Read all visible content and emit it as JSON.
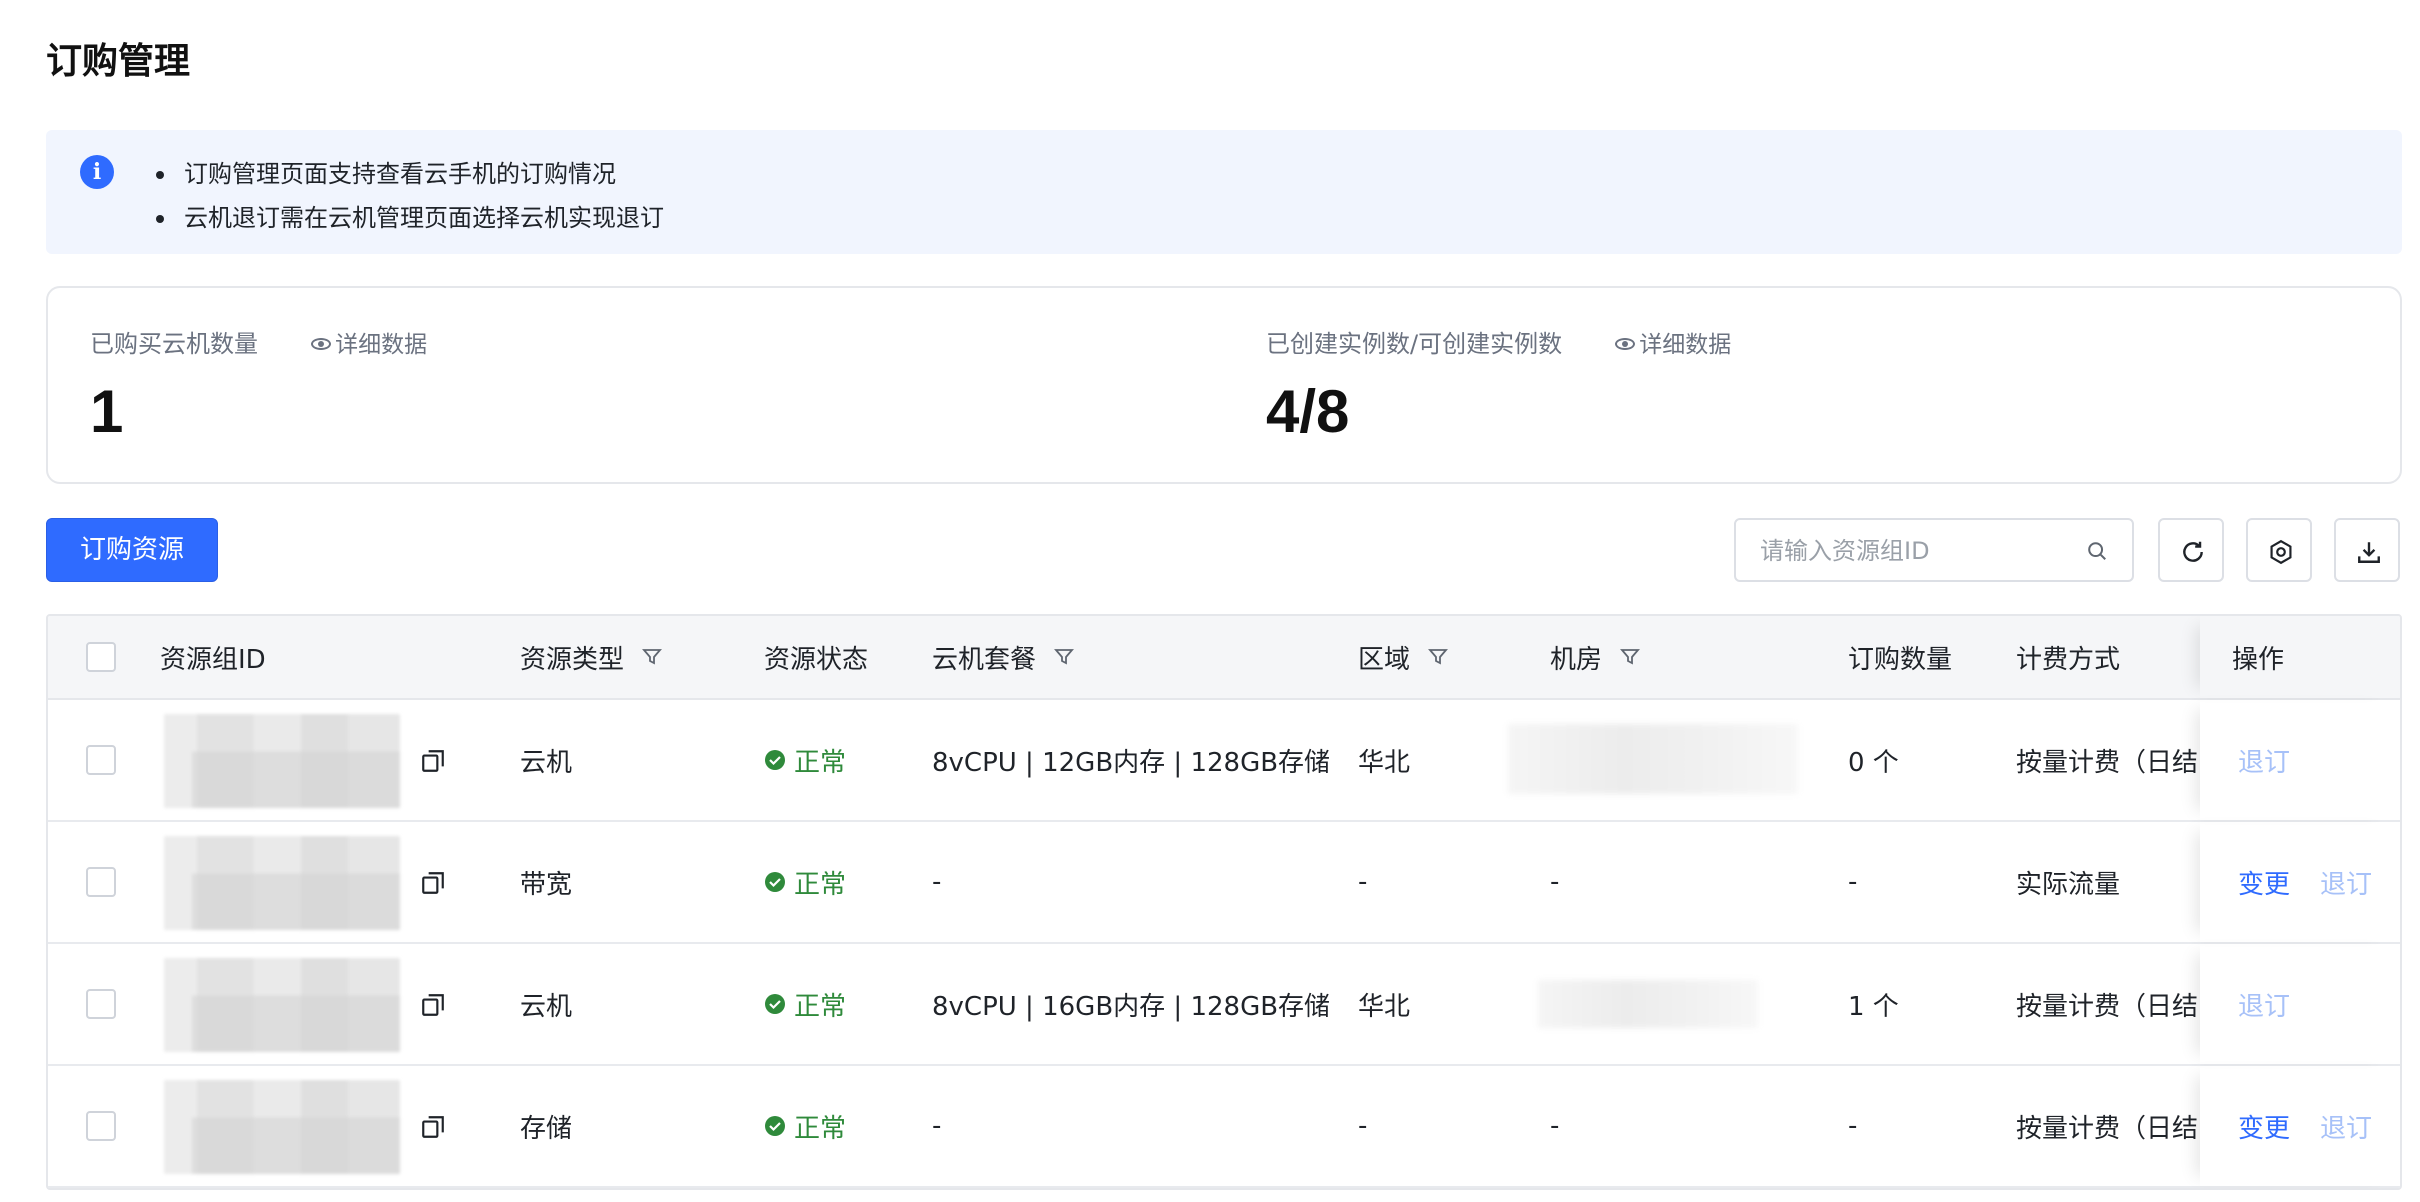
{
  "page": {
    "title": "订购管理"
  },
  "notice": {
    "items": [
      "订购管理页面支持查看云手机的订购情况",
      "云机退订需在云机管理页面选择云机实现退订"
    ]
  },
  "stats": [
    {
      "label": "已购买云机数量",
      "link": "详细数据",
      "value": "1"
    },
    {
      "label": "已创建实例数/可创建实例数",
      "link": "详细数据",
      "value": "4/8"
    }
  ],
  "toolbar": {
    "primary_label": "订购资源",
    "search_placeholder": "请输入资源组ID",
    "icons": [
      "refresh-icon",
      "settings-icon",
      "download-icon"
    ]
  },
  "table": {
    "columns": [
      "资源组ID",
      "资源类型",
      "资源状态",
      "云机套餐",
      "区域",
      "机房",
      "订购数量",
      "计费方式",
      "操作"
    ],
    "rows": [
      {
        "type": "云机",
        "status": "正常",
        "package": "8vCPU | 12GB内存 | 128GB存储",
        "region": "华北",
        "room": "",
        "count": "0 个",
        "billing": "按量计费（日结",
        "actions": [
          {
            "label": "退订",
            "enabled": false
          }
        ]
      },
      {
        "type": "带宽",
        "status": "正常",
        "package": "-",
        "region": "-",
        "room": "-",
        "count": "-",
        "billing": "实际流量",
        "actions": [
          {
            "label": "变更",
            "enabled": true
          },
          {
            "label": "退订",
            "enabled": false
          }
        ]
      },
      {
        "type": "云机",
        "status": "正常",
        "package": "8vCPU | 16GB内存 | 128GB存储",
        "region": "华北",
        "room": "",
        "count": "1 个",
        "billing": "按量计费（日结",
        "actions": [
          {
            "label": "退订",
            "enabled": false
          }
        ]
      },
      {
        "type": "存储",
        "status": "正常",
        "package": "-",
        "region": "-",
        "room": "-",
        "count": "-",
        "billing": "按量计费（日结",
        "actions": [
          {
            "label": "变更",
            "enabled": true
          },
          {
            "label": "退订",
            "enabled": false
          }
        ]
      }
    ]
  },
  "colors": {
    "primary": "#2f6bff",
    "success": "#2f8a3b",
    "disabled_link": "#a7c1f8",
    "notice_bg": "#f1f5fe"
  }
}
